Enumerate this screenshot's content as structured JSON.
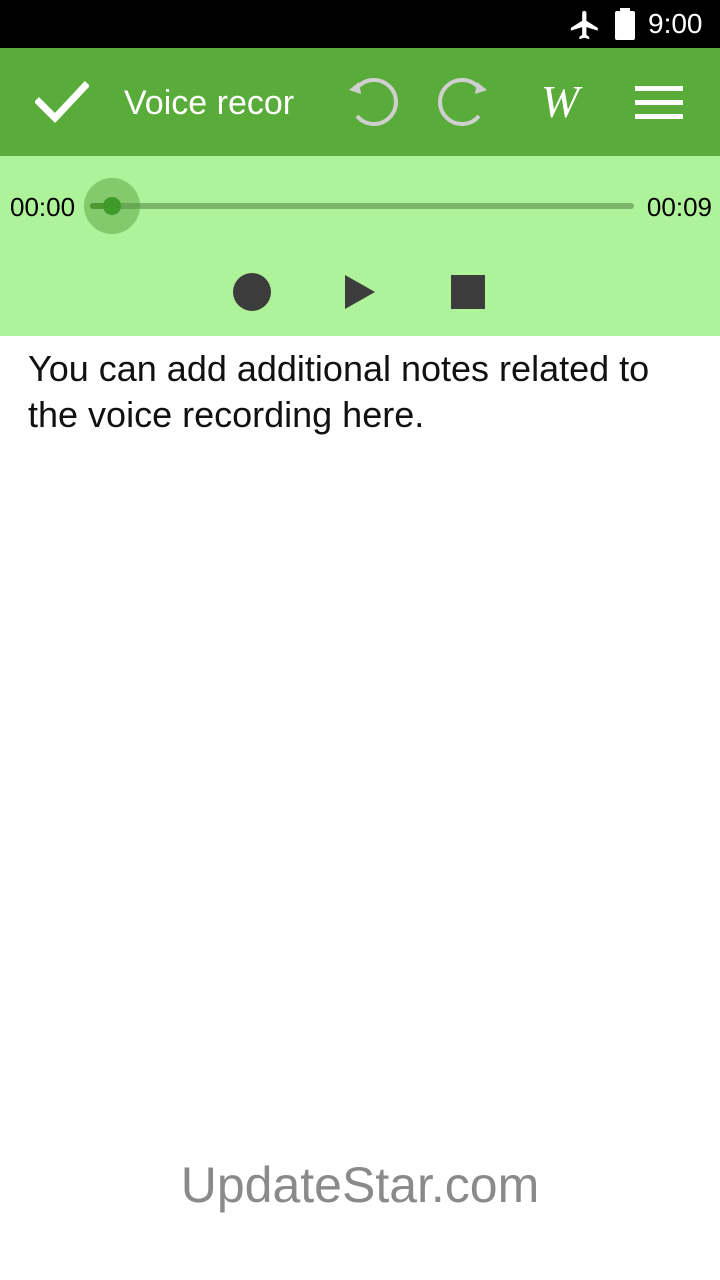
{
  "status_bar": {
    "time": "9:00",
    "icons": [
      "airplane-icon",
      "battery-icon"
    ]
  },
  "toolbar": {
    "title": "Voice recor",
    "icons": [
      "check-icon",
      "undo-icon",
      "redo-icon",
      "word-format-icon",
      "menu-icon"
    ],
    "word_glyph": "W",
    "background_color": "#5aac3a"
  },
  "player": {
    "elapsed": "00:00",
    "duration": "00:09",
    "progress_fraction": 0.04,
    "background_color": "#aef29a",
    "controls": [
      "record-icon",
      "play-icon",
      "stop-icon"
    ]
  },
  "notes": {
    "text": "You can add additional notes related to the voice recording here."
  },
  "watermark": {
    "text": "UpdateStar.com"
  }
}
